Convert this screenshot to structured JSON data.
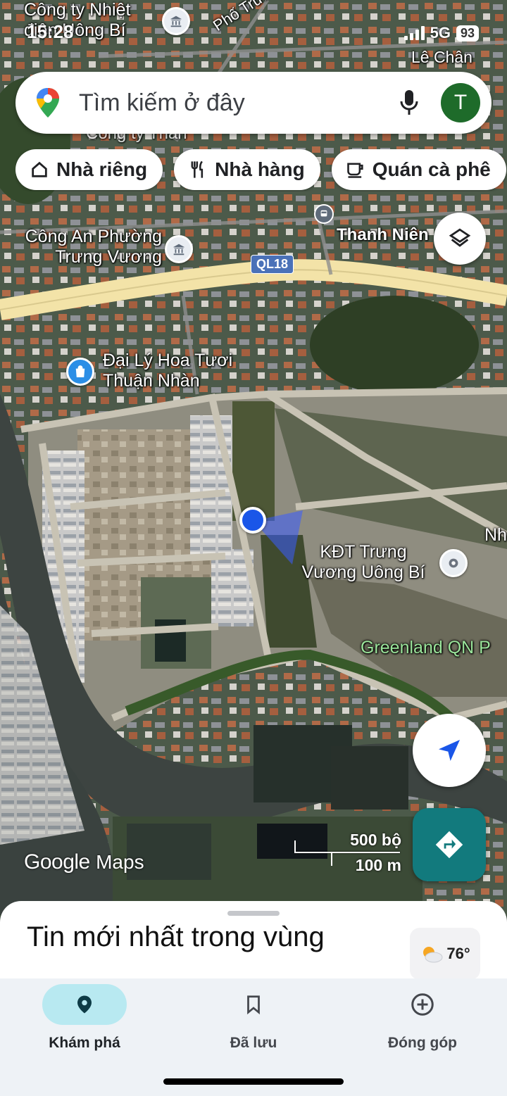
{
  "status_bar": {
    "time": "15:28",
    "network": "5G",
    "battery": "93"
  },
  "search": {
    "placeholder": "Tìm kiếm ở đây",
    "avatar_letter": "T"
  },
  "chips": [
    {
      "label": "Nhà riêng",
      "icon": "home-icon"
    },
    {
      "label": "Nhà hàng",
      "icon": "restaurant-icon"
    },
    {
      "label": "Quán cà phê",
      "icon": "cafe-icon"
    }
  ],
  "map_labels": {
    "cong_ty_nhiet_dien": "Công ty Nhiệt điện Uông Bí",
    "pho_trung_nhi": "Phố Trưng Nhị",
    "le_chan": "Lê Chân",
    "cong_ty_than": "Công ty Than",
    "thanh_nien": "Thanh Niên",
    "cong_an": "Công An Phường Trưng Vương",
    "ql18": "QL18",
    "dai_ly_hoa": "Đại Lý Hoa Tươi Thuận Nhàn",
    "kdt": "KĐT Trưng Vương Uông Bí",
    "greenland": "Greenland QN P",
    "nh": "Nh"
  },
  "scale": {
    "imperial": "500 bộ",
    "metric": "100 m"
  },
  "map_brand": {
    "google": "Google",
    "maps": "Maps"
  },
  "sheet": {
    "title": "Tin mới nhất trong vùng",
    "temperature": "76°"
  },
  "nav": [
    {
      "label": "Khám phá",
      "icon": "explore-pin-icon",
      "active": true
    },
    {
      "label": "Đã lưu",
      "icon": "bookmark-icon",
      "active": false
    },
    {
      "label": "Đóng góp",
      "icon": "add-circle-icon",
      "active": false
    }
  ],
  "colors": {
    "accent": "#127a7d",
    "location_dot": "#1a56e8",
    "nav_active": "#b8e9f1",
    "highway": "#f3e3a8"
  }
}
